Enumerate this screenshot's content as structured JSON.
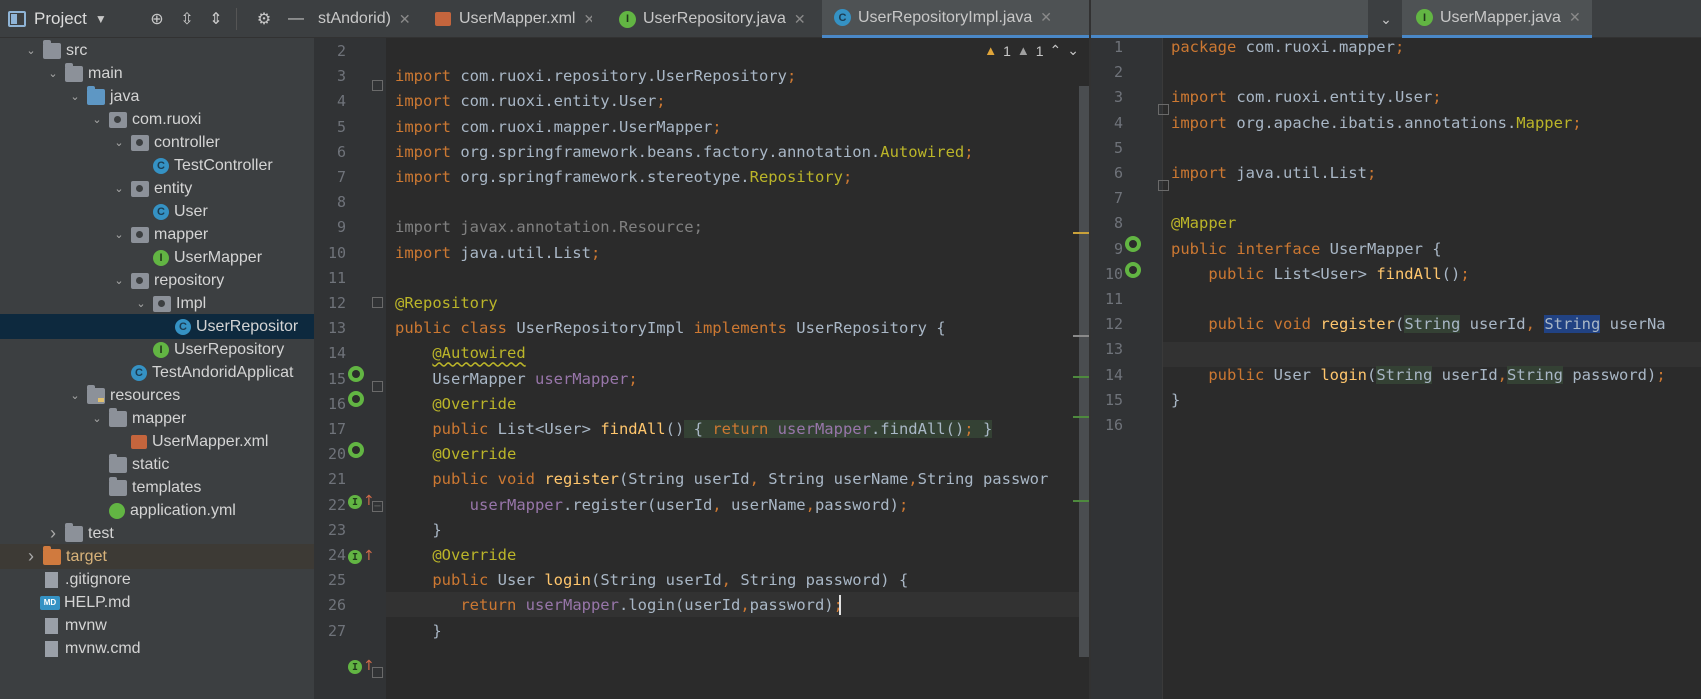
{
  "project": {
    "title": "Project",
    "tree": [
      {
        "label": "src",
        "indent": 1,
        "arrow": "down",
        "icon": "folder"
      },
      {
        "label": "main",
        "indent": 2,
        "arrow": "down",
        "icon": "folder"
      },
      {
        "label": "java",
        "indent": 3,
        "arrow": "down",
        "icon": "folder-blue"
      },
      {
        "label": "com.ruoxi",
        "indent": 4,
        "arrow": "down",
        "icon": "package"
      },
      {
        "label": "controller",
        "indent": 5,
        "arrow": "down",
        "icon": "package"
      },
      {
        "label": "TestController",
        "indent": 6,
        "arrow": "",
        "icon": "class"
      },
      {
        "label": "entity",
        "indent": 5,
        "arrow": "down",
        "icon": "package"
      },
      {
        "label": "User",
        "indent": 6,
        "arrow": "",
        "icon": "class"
      },
      {
        "label": "mapper",
        "indent": 5,
        "arrow": "down",
        "icon": "package"
      },
      {
        "label": "UserMapper",
        "indent": 6,
        "arrow": "",
        "icon": "interface"
      },
      {
        "label": "repository",
        "indent": 5,
        "arrow": "down",
        "icon": "package"
      },
      {
        "label": "Impl",
        "indent": 6,
        "arrow": "down",
        "icon": "package"
      },
      {
        "label": "UserRepositor",
        "indent": 7,
        "arrow": "",
        "icon": "class",
        "selected": true
      },
      {
        "label": "UserRepository",
        "indent": 6,
        "arrow": "",
        "icon": "interface"
      },
      {
        "label": "TestAndoridApplicat",
        "indent": 5,
        "arrow": "",
        "icon": "spring-class"
      },
      {
        "label": "resources",
        "indent": 3,
        "arrow": "down",
        "icon": "folder-res"
      },
      {
        "label": "mapper",
        "indent": 4,
        "arrow": "down",
        "icon": "folder"
      },
      {
        "label": "UserMapper.xml",
        "indent": 5,
        "arrow": "",
        "icon": "xml"
      },
      {
        "label": "static",
        "indent": 4,
        "arrow": "",
        "icon": "folder"
      },
      {
        "label": "templates",
        "indent": 4,
        "arrow": "",
        "icon": "folder"
      },
      {
        "label": "application.yml",
        "indent": 4,
        "arrow": "",
        "icon": "yml"
      },
      {
        "label": "test",
        "indent": 2,
        "arrow": "right",
        "icon": "folder"
      },
      {
        "label": "target",
        "indent": 1,
        "arrow": "right",
        "icon": "folder-orange",
        "target": true
      },
      {
        "label": ".gitignore",
        "indent": 1,
        "arrow": "",
        "icon": "file"
      },
      {
        "label": "HELP.md",
        "indent": 1,
        "arrow": "",
        "icon": "md"
      },
      {
        "label": "mvnw",
        "indent": 1,
        "arrow": "",
        "icon": "file"
      },
      {
        "label": "mvnw.cmd",
        "indent": 1,
        "arrow": "",
        "icon": "file"
      }
    ]
  },
  "tabs": {
    "left": [
      {
        "label": "stAndorid)",
        "icon": "",
        "active": false
      },
      {
        "label": "UserMapper.xml",
        "icon": "xml",
        "active": false
      },
      {
        "label": "UserRepository.java",
        "icon": "interface",
        "active": false
      },
      {
        "label": "UserRepositoryImpl.java",
        "icon": "class",
        "active": true
      }
    ],
    "right": [
      {
        "label": "UserMapper.java",
        "icon": "interface",
        "active": true
      }
    ]
  },
  "inspection": {
    "warnings": "1",
    "weak_warnings": "1"
  },
  "left_editor": {
    "lines": [
      {
        "n": "2",
        "code": []
      },
      {
        "n": "3",
        "code": [
          [
            "k",
            "import "
          ],
          [
            "t",
            "com.ruoxi.repository.UserRepository"
          ],
          [
            "k",
            ";"
          ]
        ]
      },
      {
        "n": "4",
        "code": [
          [
            "k",
            "import "
          ],
          [
            "t",
            "com.ruoxi.entity.User"
          ],
          [
            "k",
            ";"
          ]
        ]
      },
      {
        "n": "5",
        "code": [
          [
            "k",
            "import "
          ],
          [
            "t",
            "com.ruoxi.mapper.UserMapper"
          ],
          [
            "k",
            ";"
          ]
        ]
      },
      {
        "n": "6",
        "code": [
          [
            "k",
            "import "
          ],
          [
            "t",
            "org.springframework.beans.factory.annotation."
          ],
          [
            "a",
            "Autowired"
          ],
          [
            "k",
            ";"
          ]
        ]
      },
      {
        "n": "7",
        "code": [
          [
            "k",
            "import "
          ],
          [
            "t",
            "org.springframework.stereotype."
          ],
          [
            "a",
            "Repository"
          ],
          [
            "k",
            ";"
          ]
        ]
      },
      {
        "n": "8",
        "code": []
      },
      {
        "n": "9",
        "code": [
          [
            "g",
            "import javax.annotation.Resource;"
          ]
        ]
      },
      {
        "n": "10",
        "code": [
          [
            "k",
            "import "
          ],
          [
            "t",
            "java.util.List"
          ],
          [
            "k",
            ";"
          ]
        ]
      },
      {
        "n": "11",
        "code": []
      },
      {
        "n": "12",
        "code": [
          [
            "a",
            "@Repository"
          ]
        ]
      },
      {
        "n": "13",
        "code": [
          [
            "k",
            "public class "
          ],
          [
            "t",
            "UserRepositoryImpl "
          ],
          [
            "k",
            "implements "
          ],
          [
            "t",
            "UserRepository {"
          ]
        ]
      },
      {
        "n": "14",
        "code": [
          [
            "t",
            "    "
          ],
          [
            "aw",
            "@Autowired"
          ]
        ]
      },
      {
        "n": "15",
        "code": [
          [
            "t",
            "    UserMapper "
          ],
          [
            "v",
            "userMapper"
          ],
          [
            "k",
            ";"
          ]
        ]
      },
      {
        "n": "16",
        "code": [
          [
            "t",
            "    "
          ],
          [
            "a",
            "@Override"
          ]
        ]
      },
      {
        "n": "17",
        "code": [
          [
            "t",
            "    "
          ],
          [
            "k",
            "public "
          ],
          [
            "t",
            "List<User> "
          ],
          [
            "f",
            "findAll"
          ],
          [
            "t",
            "()"
          ],
          [
            "hl",
            " { "
          ],
          [
            "hlk",
            "return "
          ],
          [
            "hlv",
            "userMapper"
          ],
          [
            "hl",
            ".findAll()"
          ],
          [
            "hlk",
            ";"
          ],
          [
            "hl",
            " }"
          ]
        ]
      },
      {
        "n": "20",
        "code": [
          [
            "t",
            "    "
          ],
          [
            "a",
            "@Override"
          ]
        ]
      },
      {
        "n": "21",
        "code": [
          [
            "t",
            "    "
          ],
          [
            "k",
            "public void "
          ],
          [
            "f",
            "register"
          ],
          [
            "t",
            "(String userId"
          ],
          [
            "k",
            ", "
          ],
          [
            "t",
            "String userName"
          ],
          [
            "k",
            ","
          ],
          [
            "t",
            "String passwor"
          ]
        ]
      },
      {
        "n": "22",
        "code": [
          [
            "t",
            "        "
          ],
          [
            "v",
            "userMapper"
          ],
          [
            "t",
            ".register(userId"
          ],
          [
            "k",
            ", "
          ],
          [
            "t",
            "userName"
          ],
          [
            "k",
            ","
          ],
          [
            "t",
            "password)"
          ],
          [
            "k",
            ";"
          ]
        ]
      },
      {
        "n": "23",
        "code": [
          [
            "t",
            "    }"
          ]
        ]
      },
      {
        "n": "24",
        "code": [
          [
            "t",
            "    "
          ],
          [
            "a",
            "@Override"
          ]
        ]
      },
      {
        "n": "25",
        "code": [
          [
            "t",
            "    "
          ],
          [
            "k",
            "public "
          ],
          [
            "t",
            "User "
          ],
          [
            "f",
            "login"
          ],
          [
            "t",
            "(String userId"
          ],
          [
            "k",
            ", "
          ],
          [
            "t",
            "String password) {"
          ]
        ]
      },
      {
        "n": "26",
        "code": [
          [
            "t",
            "       "
          ],
          [
            "k",
            "return "
          ],
          [
            "v",
            "userMapper"
          ],
          [
            "t",
            ".login(userId"
          ],
          [
            "k",
            ","
          ],
          [
            "t",
            "password)"
          ],
          [
            "k",
            ";"
          ]
        ]
      },
      {
        "n": "27",
        "code": [
          [
            "t",
            "    }"
          ]
        ]
      }
    ]
  },
  "right_editor": {
    "lines": [
      {
        "n": "1",
        "code": [
          [
            "k",
            "package "
          ],
          [
            "t",
            "com.ruoxi.mapper"
          ],
          [
            "k",
            ";"
          ]
        ]
      },
      {
        "n": "2",
        "code": []
      },
      {
        "n": "3",
        "code": [
          [
            "k",
            "import "
          ],
          [
            "t",
            "com.ruoxi.entity.User"
          ],
          [
            "k",
            ";"
          ]
        ]
      },
      {
        "n": "4",
        "code": [
          [
            "k",
            "import "
          ],
          [
            "t",
            "org.apache.ibatis.annotations."
          ],
          [
            "a",
            "Mapper"
          ],
          [
            "k",
            ";"
          ]
        ]
      },
      {
        "n": "5",
        "code": []
      },
      {
        "n": "6",
        "code": [
          [
            "k",
            "import "
          ],
          [
            "t",
            "java.util.List"
          ],
          [
            "k",
            ";"
          ]
        ]
      },
      {
        "n": "7",
        "code": []
      },
      {
        "n": "8",
        "code": [
          [
            "a",
            "@Mapper"
          ]
        ]
      },
      {
        "n": "9",
        "code": [
          [
            "k",
            "public interface "
          ],
          [
            "t",
            "UserMapper {"
          ]
        ]
      },
      {
        "n": "10",
        "code": [
          [
            "t",
            "    "
          ],
          [
            "k",
            "public "
          ],
          [
            "t",
            "List<User> "
          ],
          [
            "f",
            "findAll"
          ],
          [
            "t",
            "()"
          ],
          [
            "k",
            ";"
          ]
        ]
      },
      {
        "n": "11",
        "code": []
      },
      {
        "n": "12",
        "code": [
          [
            "t",
            "    "
          ],
          [
            "k",
            "public void "
          ],
          [
            "f",
            "register"
          ],
          [
            "t",
            "("
          ],
          [
            "hlt",
            "String"
          ],
          [
            "t",
            " userId"
          ],
          [
            "k",
            ", "
          ],
          [
            "hl2t",
            "String"
          ],
          [
            "t",
            " userNa"
          ]
        ]
      },
      {
        "n": "13",
        "code": []
      },
      {
        "n": "14",
        "code": [
          [
            "t",
            "    "
          ],
          [
            "k",
            "public "
          ],
          [
            "t",
            "User "
          ],
          [
            "f",
            "login"
          ],
          [
            "t",
            "("
          ],
          [
            "hlt",
            "String"
          ],
          [
            "t",
            " userId"
          ],
          [
            "k",
            ","
          ],
          [
            "hlt",
            "String"
          ],
          [
            "t",
            " password)"
          ],
          [
            "k",
            ";"
          ]
        ]
      },
      {
        "n": "15",
        "code": [
          [
            "t",
            "}"
          ]
        ]
      },
      {
        "n": "16",
        "code": []
      }
    ]
  }
}
